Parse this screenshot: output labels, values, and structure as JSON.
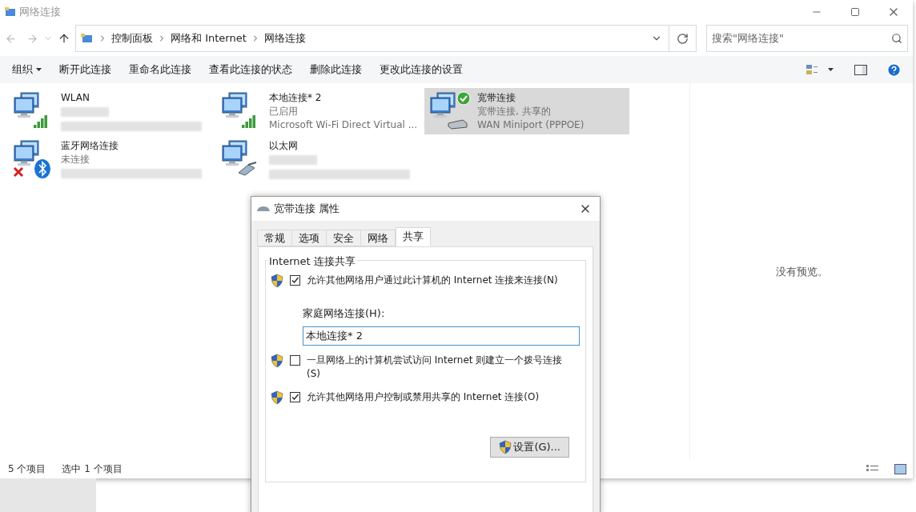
{
  "window": {
    "title": "网络连接"
  },
  "address": {
    "crumbs": [
      "控制面板",
      "网络和 Internet",
      "网络连接"
    ]
  },
  "search": {
    "placeholder": "搜索\"网络连接\""
  },
  "commands": [
    {
      "label": "组织",
      "kind": "menu"
    },
    {
      "label": "断开此连接",
      "kind": "plain"
    },
    {
      "label": "重命名此连接",
      "kind": "plain"
    },
    {
      "label": "查看此连接的状态",
      "kind": "plain"
    },
    {
      "label": "删除此连接",
      "kind": "plain"
    },
    {
      "label": "更改此连接的设置",
      "kind": "plain"
    }
  ],
  "connections": [
    {
      "name": "WLAN",
      "kind": "wifi",
      "selected": false
    },
    {
      "name": "本地连接* 2",
      "status": "已启用",
      "device": "Microsoft Wi-Fi Direct Virtual ...",
      "kind": "wifi",
      "selected": false
    },
    {
      "name": "宽带连接",
      "status": "宽带连接, 共享的",
      "device": "WAN Miniport (PPPOE)",
      "kind": "broadband",
      "selected": true
    },
    {
      "name": "蓝牙网络连接",
      "status": "未连接",
      "kind": "bluetooth",
      "selected": false
    },
    {
      "name": "以太网",
      "kind": "ethernet",
      "selected": false
    }
  ],
  "preview": {
    "text": "没有预览。"
  },
  "status_bar": {
    "count": "5 个项目",
    "selection": "选中 1 个项目"
  },
  "dialog": {
    "title": "宽带连接 属性",
    "tabs": [
      {
        "label": "常规",
        "selected": false
      },
      {
        "label": "选项",
        "selected": false
      },
      {
        "label": "安全",
        "selected": false
      },
      {
        "label": "网络",
        "selected": false
      },
      {
        "label": "共享",
        "selected": true
      }
    ],
    "group_title": "Internet 连接共享",
    "options": [
      {
        "label": "允许其他网络用户通过此计算机的 Internet 连接来连接(N)",
        "checked": true
      },
      {
        "label": "一旦网络上的计算机尝试访问 Internet 则建立一个拨号连接(S)",
        "checked": false
      },
      {
        "label": "允许其他网络用户控制或禁用共享的 Internet 连接(O)",
        "checked": true
      }
    ],
    "home_network": {
      "label": "家庭网络连接(H):",
      "value": "本地连接* 2"
    },
    "settings_button": "设置(G)..."
  }
}
